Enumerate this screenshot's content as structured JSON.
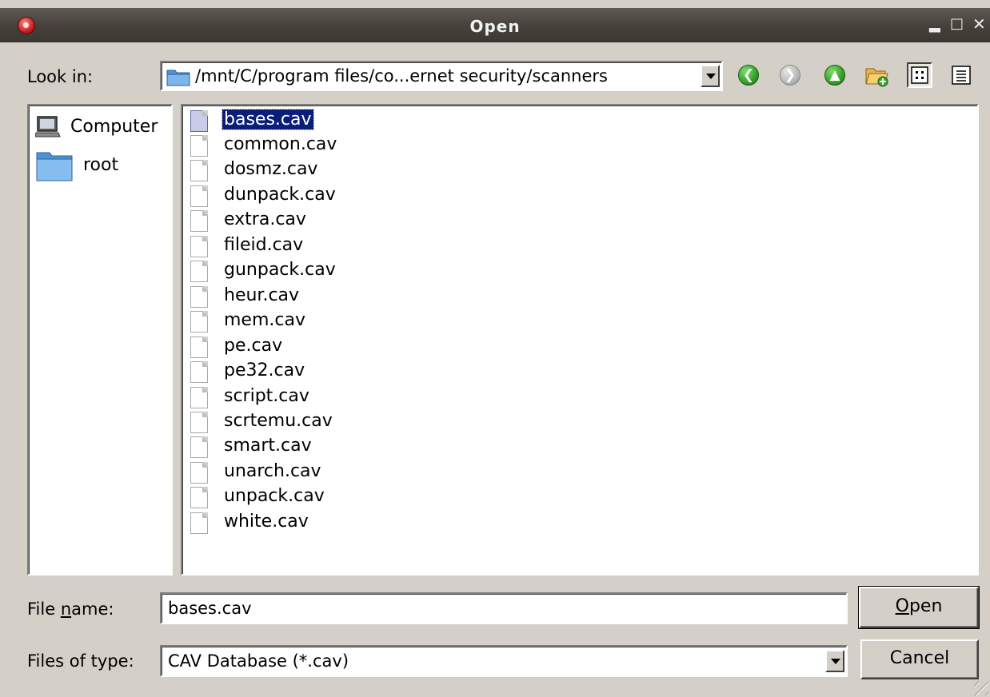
{
  "window": {
    "title": "Open"
  },
  "lookin": {
    "label": "Look in:",
    "path": "/mnt/C/program files/co...ernet security/scanners"
  },
  "toolbar": {
    "back_icon": "back-arrow-icon",
    "forward_icon": "forward-arrow-icon",
    "up_icon": "up-arrow-icon",
    "new_folder_icon": "new-folder-icon",
    "list_view_icon": "list-view-icon",
    "details_view_icon": "details-view-icon"
  },
  "places": [
    {
      "label": "Computer",
      "icon": "computer-icon"
    },
    {
      "label": "root",
      "icon": "folder-icon"
    }
  ],
  "files": [
    {
      "name": "bases.cav",
      "selected": true
    },
    {
      "name": "common.cav"
    },
    {
      "name": "dosmz.cav"
    },
    {
      "name": "dunpack.cav"
    },
    {
      "name": "extra.cav"
    },
    {
      "name": "fileid.cav"
    },
    {
      "name": "gunpack.cav"
    },
    {
      "name": "heur.cav"
    },
    {
      "name": "mem.cav"
    },
    {
      "name": "pe.cav"
    },
    {
      "name": "pe32.cav"
    },
    {
      "name": "script.cav"
    },
    {
      "name": "scrtemu.cav"
    },
    {
      "name": "smart.cav"
    },
    {
      "name": "unarch.cav"
    },
    {
      "name": "unpack.cav"
    },
    {
      "name": "white.cav"
    }
  ],
  "filename": {
    "label_pre": "File ",
    "label_mnemonic": "n",
    "label_post": "ame:",
    "value": "bases.cav"
  },
  "filetype": {
    "label": "Files of type:",
    "value": "CAV Database (*.cav)"
  },
  "buttons": {
    "open_mnemonic": "O",
    "open_rest": "pen",
    "cancel": "Cancel"
  },
  "colors": {
    "selection": "#0a1e78",
    "titlebar": "#45403a",
    "dialog": "#d4d0c8"
  }
}
